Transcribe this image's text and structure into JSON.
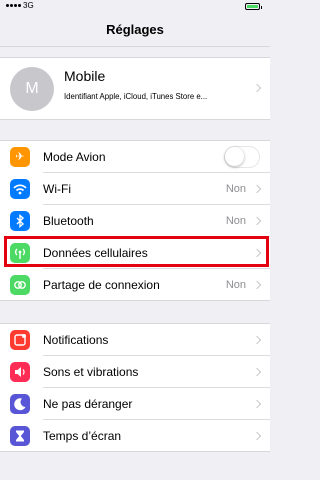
{
  "status_bar": {
    "network": "3G"
  },
  "nav": {
    "title": "Réglages"
  },
  "profile": {
    "avatar_letter": "M",
    "name": "Mobile",
    "subtitle": "Identifiant Apple, iCloud, iTunes Store e..."
  },
  "connectivity": [
    {
      "label": "Mode Avion",
      "icon": "airplane-icon",
      "color": "#ff9500",
      "toggle": false
    },
    {
      "label": "Wi-Fi",
      "icon": "wifi-icon",
      "color": "#007aff",
      "value": "Non"
    },
    {
      "label": "Bluetooth",
      "icon": "bluetooth-icon",
      "color": "#007aff",
      "value": "Non"
    },
    {
      "label": "Données cellulaires",
      "icon": "cellular-icon",
      "color": "#4cd964",
      "highlighted": true
    },
    {
      "label": "Partage de connexion",
      "icon": "hotspot-icon",
      "color": "#4cd964",
      "value": "Non"
    }
  ],
  "notifications": [
    {
      "label": "Notifications",
      "icon": "notifications-icon",
      "color": "#ff3b30"
    },
    {
      "label": "Sons et vibrations",
      "icon": "sound-icon",
      "color": "#ff2d55"
    },
    {
      "label": "Ne pas déranger",
      "icon": "moon-icon",
      "color": "#5856d6"
    },
    {
      "label": "Temps d’écran",
      "icon": "hourglass-icon",
      "color": "#5856d6"
    }
  ],
  "highlight_color": "#e3000f"
}
